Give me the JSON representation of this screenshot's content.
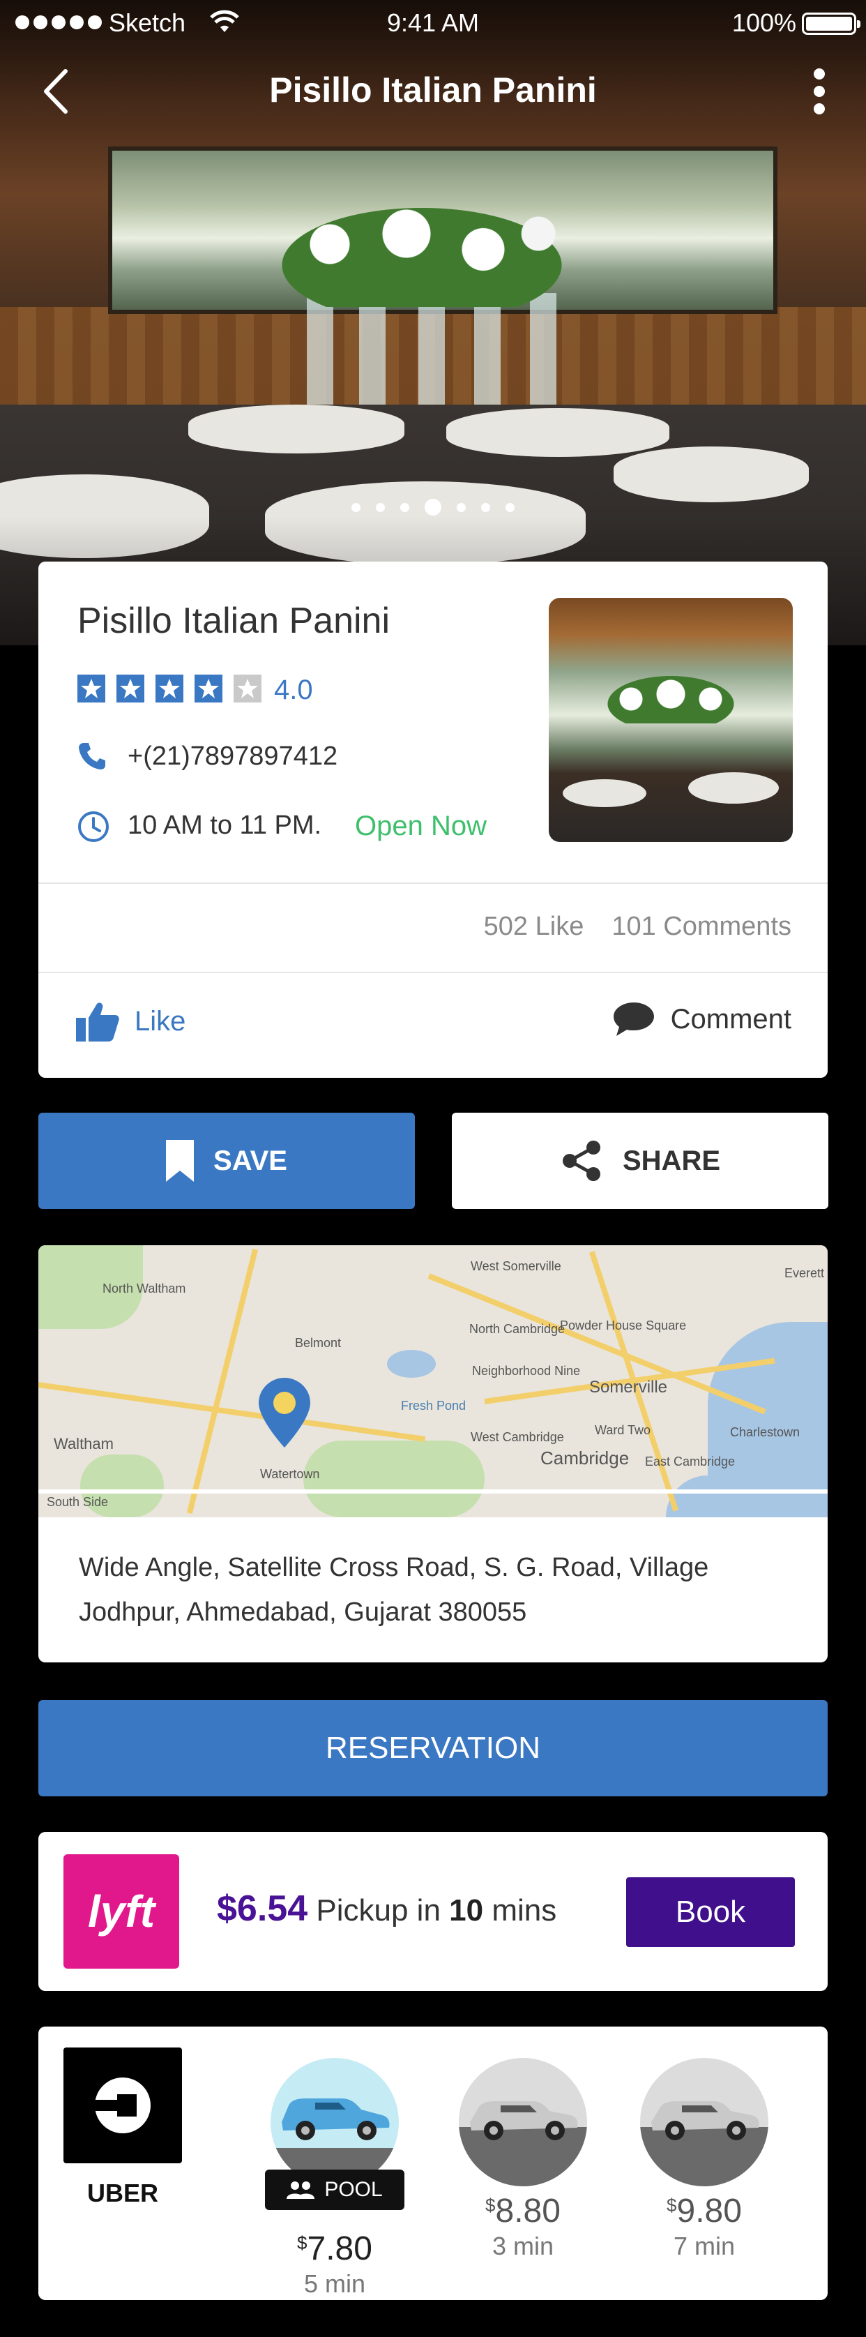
{
  "status_bar": {
    "carrier": "Sketch",
    "time": "9:41 AM",
    "battery": "100%"
  },
  "header": {
    "title": "Pisillo Italian Panini",
    "back_icon": "chevron-left-icon",
    "more_icon": "more-vertical-icon"
  },
  "gallery": {
    "page_count": 7,
    "active_index": 3
  },
  "restaurant": {
    "name": "Pisillo Italian Panini",
    "rating_value": 4,
    "rating_max": 5,
    "rating": "4.0",
    "phone": "+(21)7897897412",
    "hours": "10 AM to 11 PM.",
    "open_status": "Open Now",
    "likes": "502 Like",
    "comments": "101 Comments",
    "like_label": "Like",
    "comment_label": "Comment"
  },
  "actions": {
    "save_label": "SAVE",
    "share_label": "SHARE"
  },
  "location": {
    "address": "Wide Angle, Satellite Cross Road, S. G. Road, Village Jodhpur, Ahmedabad, Gujarat 380055",
    "map_labels": [
      "North Waltham",
      "Belmont",
      "North Cambridge",
      "Powder House Square",
      "Neighborhood Nine",
      "Somerville",
      "West Somerville",
      "Ward Two",
      "West Cambridge",
      "Cambridge",
      "East Cambridge",
      "Charlestown",
      "Waltham",
      "Watertown",
      "Everett",
      "South Side",
      "Fresh Pond"
    ]
  },
  "reservation_label": "RESERVATION",
  "lyft": {
    "logo_text": "lyft",
    "price": "$6.54",
    "pickup_prefix": "Pickup in",
    "pickup_minutes": "10",
    "pickup_suffix": "mins",
    "book_label": "Book"
  },
  "uber": {
    "name": "UBER",
    "rides": [
      {
        "badge": "POOL",
        "currency": "$",
        "price": "7.80",
        "eta": "5 min"
      },
      {
        "currency": "$",
        "price": "8.80",
        "eta": "3 min"
      },
      {
        "currency": "$",
        "price": "9.80",
        "eta": "7 min"
      }
    ]
  },
  "colors": {
    "primary": "#3b78c3",
    "open_green": "#3fbf6c",
    "lyft_pink": "#e1188c",
    "lyft_purple": "#3f0f8c"
  }
}
